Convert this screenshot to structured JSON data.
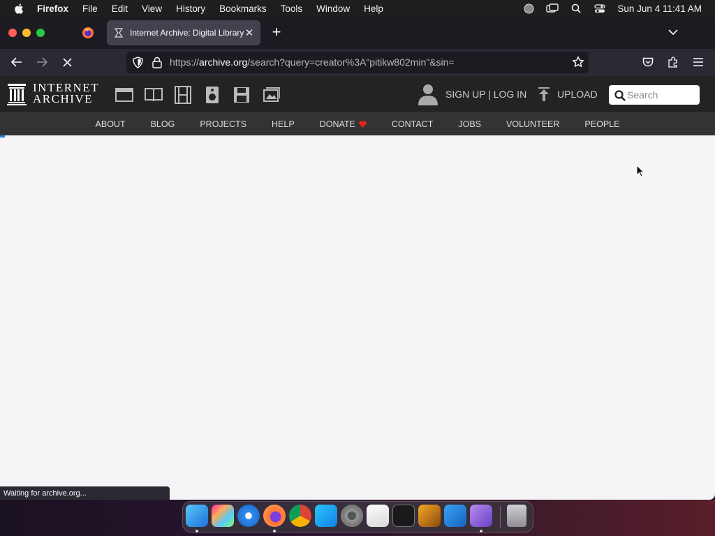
{
  "menubar": {
    "app": "Firefox",
    "items": [
      "File",
      "Edit",
      "View",
      "History",
      "Bookmarks",
      "Tools",
      "Window",
      "Help"
    ],
    "clock": "Sun Jun 4  11:41 AM"
  },
  "browser": {
    "tab_title": "Internet Archive: Digital Library",
    "url_prefix": "https://",
    "url_domain": "archive.org",
    "url_path": "/search?query=creator%3A\"pitikw802min\"&sin=",
    "status_text": "Waiting for archive.org..."
  },
  "archive": {
    "logo_line1": "INTERNET",
    "logo_line2": "ARCHIVE",
    "signup_label": "SIGN UP | LOG IN",
    "upload_label": "UPLOAD",
    "search_placeholder": "Search",
    "nav": {
      "about": "ABOUT",
      "blog": "BLOG",
      "projects": "PROJECTS",
      "help": "HELP",
      "donate": "DONATE",
      "contact": "CONTACT",
      "jobs": "JOBS",
      "volunteer": "VOLUNTEER",
      "people": "PEOPLE"
    }
  },
  "colors": {
    "accent": "#2a7cd6",
    "donate_heart": "#e2231a"
  }
}
